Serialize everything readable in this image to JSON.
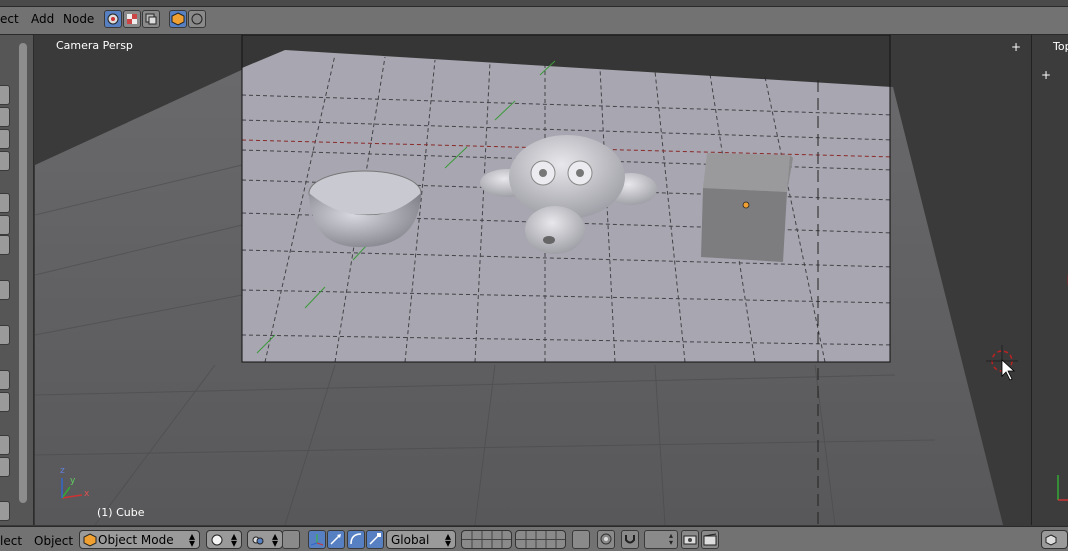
{
  "header": {
    "menus": [
      "ect",
      "Add",
      "Node"
    ]
  },
  "viewport": {
    "view_label": "Camera Persp",
    "selection_label": "(1) Cube",
    "axis_labels": {
      "x": "x",
      "y": "y",
      "z": "z"
    },
    "objects": [
      "bowl",
      "monkey-head",
      "cube"
    ]
  },
  "right_panel": {
    "view_label": "Top"
  },
  "footer": {
    "menus": [
      "lect",
      "Object"
    ],
    "mode": "Object Mode",
    "orientation": "Global"
  },
  "colors": {
    "accent": "#5680c2",
    "header_bg": "#727272",
    "viewport_bg": "#3a3a3a",
    "camera_bg": "#a8a6b0"
  }
}
